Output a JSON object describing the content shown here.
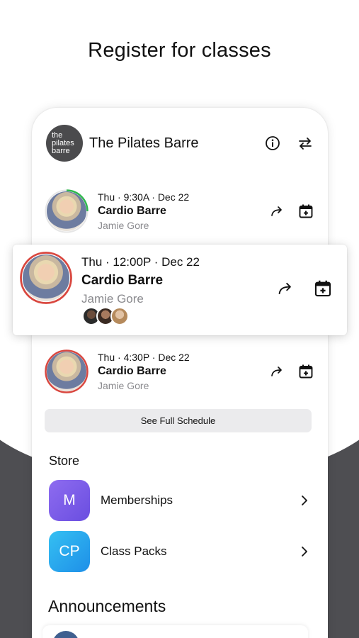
{
  "headline": "Register for classes",
  "studio": {
    "logo_lines": [
      "the",
      "pilates",
      "barre"
    ],
    "name": "The Pilates Barre",
    "info_icon": "info-icon",
    "switch_icon": "swap-arrows-icon"
  },
  "classes": [
    {
      "time": "Thu · 9:30A · Dec 22",
      "title": "Cardio Barre",
      "instructor": "Jamie Gore",
      "ring_color": "#2fb84d"
    },
    {
      "time": "Thu · 12:00P · Dec 22",
      "title": "Cardio Barre",
      "instructor": "Jamie Gore",
      "ring_color": "#d9473f"
    },
    {
      "time": "Thu · 4:30P · Dec 22",
      "title": "Cardio Barre",
      "instructor": "Jamie Gore",
      "ring_color": "#d9473f"
    }
  ],
  "see_full_schedule": "See Full Schedule",
  "store": {
    "title": "Store",
    "items": [
      {
        "badge": "M",
        "label": "Memberships",
        "color": "#7b5ce6"
      },
      {
        "badge": "CP",
        "label": "Class Packs",
        "color": "#2aa6ee"
      }
    ]
  },
  "announcements": {
    "title": "Announcements"
  },
  "colors": {
    "dark_band": "#4e4e52",
    "button_bg": "#ebebed",
    "muted_text": "#8a8a8e"
  }
}
